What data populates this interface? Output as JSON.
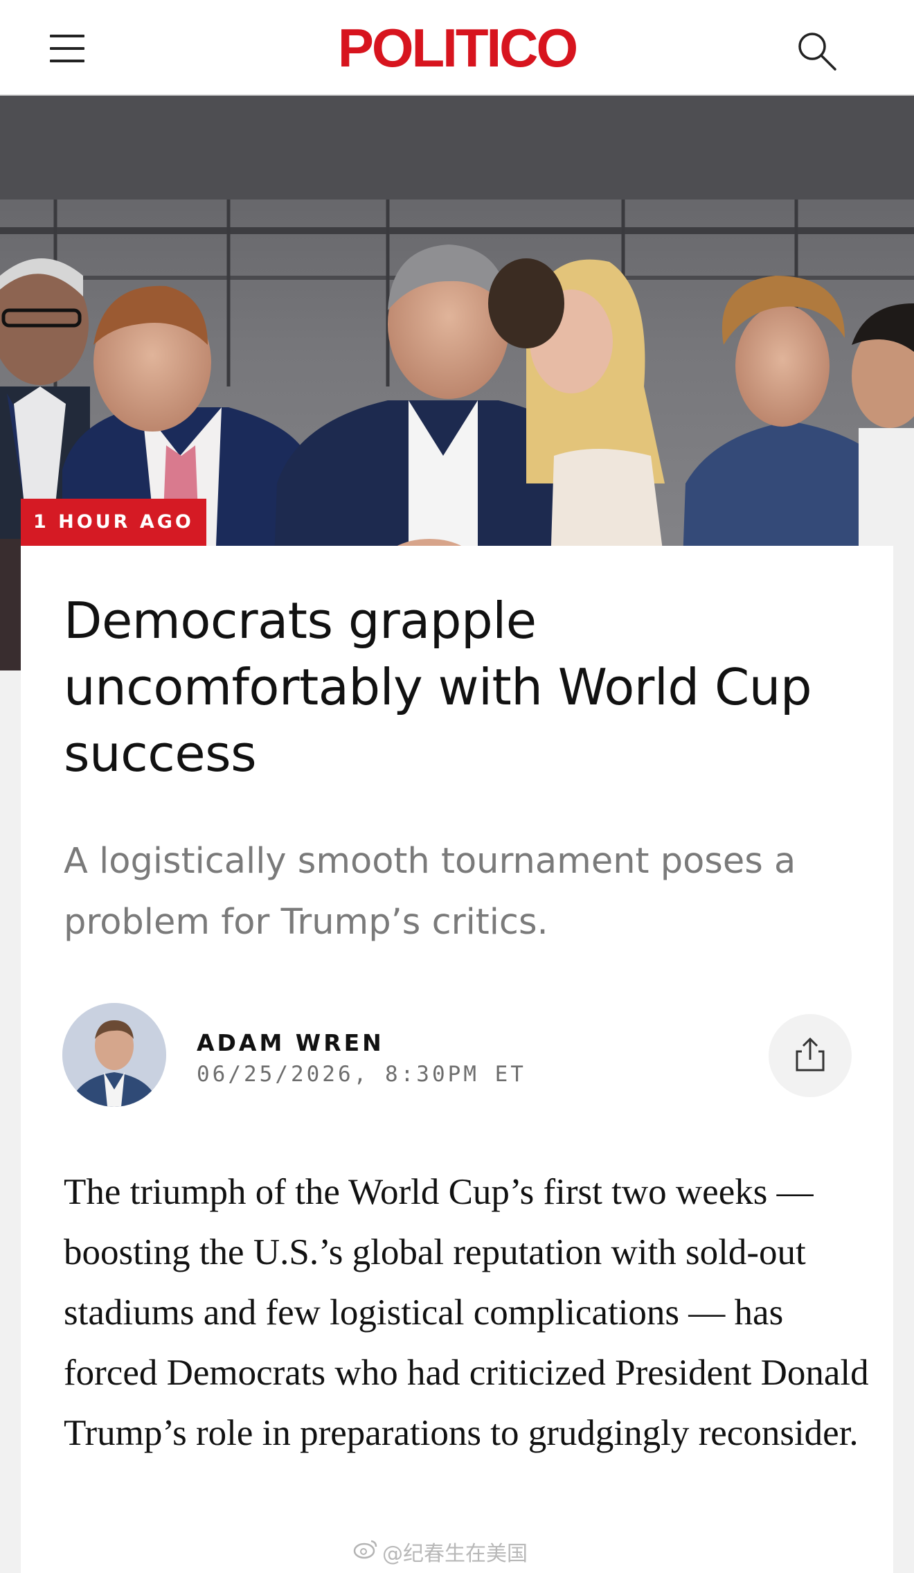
{
  "header": {
    "logo_text": "POLITICO",
    "menu_icon": "hamburger-menu-icon",
    "search_icon": "magnifying-glass-icon",
    "brand_color": "#d7141e"
  },
  "hero": {
    "badge_text": "1 HOUR AGO",
    "badge_color": "#d51a24"
  },
  "article": {
    "headline": "Democrats grapple uncomfortably with World Cup success",
    "dek": "A logistically smooth tournament poses a problem for Trump’s critics.",
    "author": "ADAM WREN",
    "date": "06/25/2026, 8:30PM ET",
    "share_icon": "share-icon",
    "body": "The triumph of the World Cup’s first two weeks — boosting the U.S.’s global reputation with sold-out stadiums and few logistical complications — has forced Democrats who had criticized President Donald Trump’s role in preparations to grudgingly reconsider."
  },
  "watermark": {
    "text": "@纪春生在美国"
  }
}
